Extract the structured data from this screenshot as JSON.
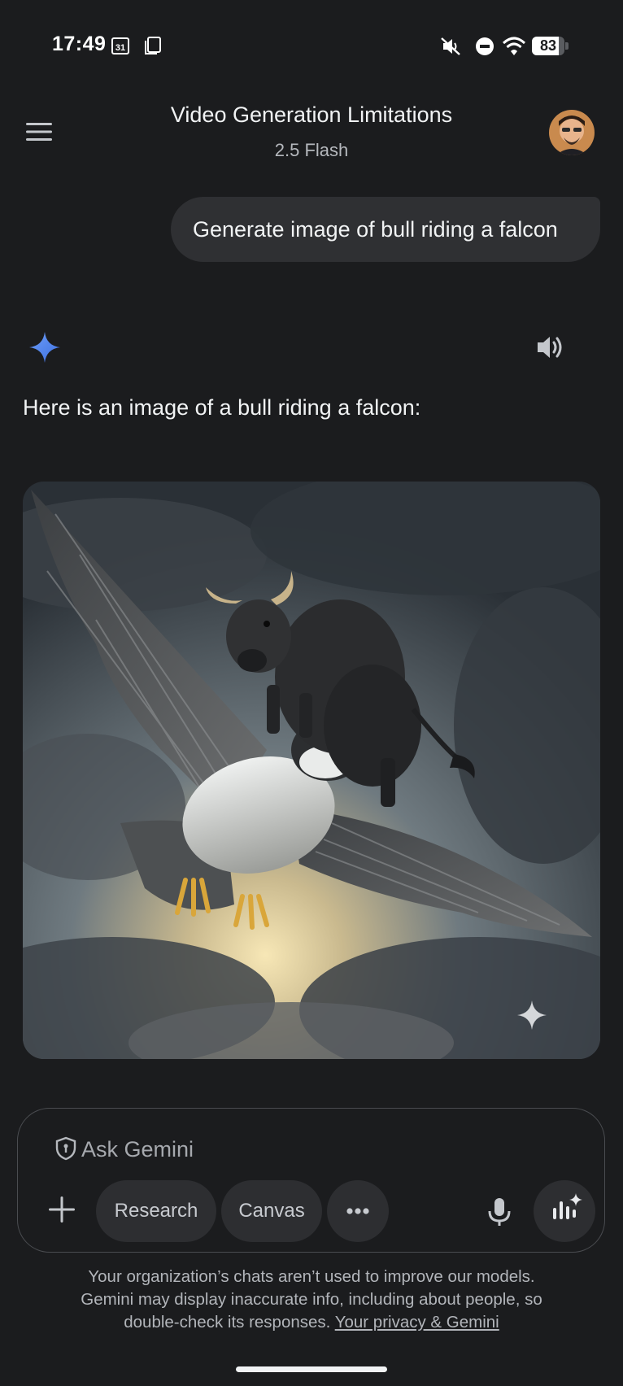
{
  "status_bar": {
    "time": "17:49",
    "calendar_day": "31",
    "battery_level": "83",
    "battery_fraction": 0.83,
    "icons": [
      "calendar-icon",
      "screenshot-icon",
      "mute-icon",
      "do-not-disturb-icon",
      "wifi-icon",
      "battery-icon"
    ]
  },
  "header": {
    "title": "Video Generation Limitations",
    "subtitle": "2.5 Flash",
    "menu_icon": "hamburger-menu-icon",
    "avatar_icon": "user-avatar"
  },
  "conversation": {
    "user_message": "Generate image of bull riding a falcon",
    "response_icon": "gemini-spark-icon",
    "read_aloud_icon": "speaker-icon",
    "response_text": "Here is an image of a bull riding a falcon:",
    "image_badge_icon": "sparkle-icon"
  },
  "input": {
    "placeholder": "Ask Gemini",
    "shield_icon": "shield-icon",
    "add_icon": "plus-icon",
    "chips": {
      "research": "Research",
      "canvas": "Canvas",
      "more_icon": "more-horizontal-icon"
    },
    "mic_icon": "microphone-icon",
    "live_icon": "live-audio-icon"
  },
  "disclaimer": {
    "line1": "Your organization’s chats aren’t used to improve our models.",
    "line2": "Gemini may display inaccurate info, including about people, so",
    "line3_prefix": "double-check its responses.",
    "link": "Your privacy & Gemini"
  },
  "colors": {
    "background": "#1b1c1e",
    "bubble": "#2f3033",
    "chip": "#2d2e31",
    "spark_blue": "#4f8df5",
    "text_primary": "#f1f3f4",
    "text_secondary": "#b2b5ba"
  }
}
